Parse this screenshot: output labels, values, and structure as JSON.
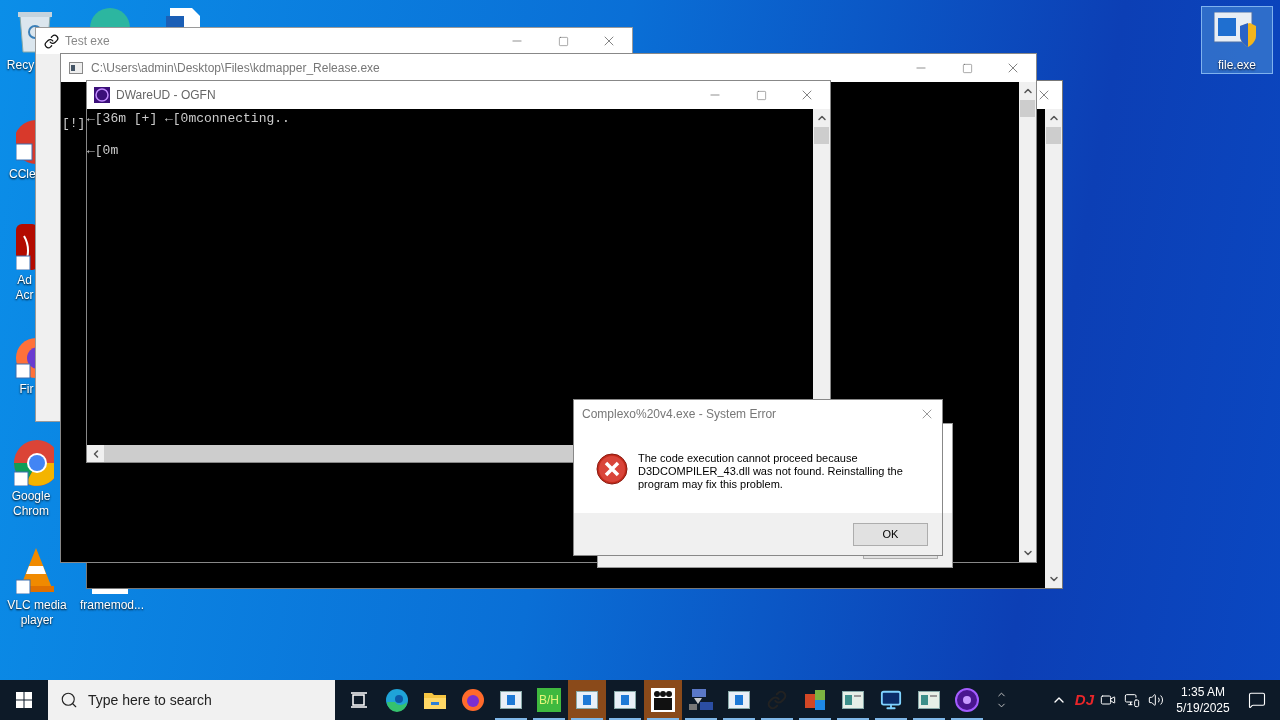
{
  "desktop_icons": [
    {
      "kind": "recycle",
      "label": "Recy"
    },
    {
      "kind": "edge"
    },
    {
      "kind": "document"
    },
    {
      "kind": "ccleaner",
      "label": "CCle"
    },
    {
      "kind": "acrobat",
      "label": "Ad\nAcr"
    },
    {
      "kind": "firefox",
      "label": "Fir"
    },
    {
      "kind": "chrome",
      "label": "Google\nChrom"
    },
    {
      "kind": "vlc",
      "label": "VLC media\nplayer"
    },
    {
      "kind": "blank",
      "label": "framemod..."
    },
    {
      "kind": "shield",
      "label": "file.exe",
      "selected": true
    }
  ],
  "test_window": {
    "title": "Test exe"
  },
  "kdmapper_window": {
    "title": "C:\\Users\\admin\\Desktop\\Files\\kdmapper_Release.exe",
    "lines": [
      "[!]"
    ]
  },
  "dware_window": {
    "title": "DWareUD - OGFN",
    "lines": [
      "←[36m [+] ←[0mconnecting..",
      "←[0m"
    ]
  },
  "error_dialog": {
    "title": "Complexo%20v4.exe - System Error",
    "message": "The code execution cannot proceed because D3DCOMPILER_43.dll was not found. Reinstalling the program may fix this problem.",
    "button": "OK"
  },
  "taskbar": {
    "search": {
      "placeholder": "Type here to search"
    },
    "apps": [
      {
        "kind": "taskview",
        "running": false,
        "active": false
      },
      {
        "kind": "edge",
        "running": false,
        "active": false
      },
      {
        "kind": "folder",
        "running": false,
        "active": false
      },
      {
        "kind": "firefox",
        "running": false,
        "active": false
      },
      {
        "kind": "window",
        "running": true,
        "active": false
      },
      {
        "kind": "text",
        "label": "B/H",
        "running": true,
        "active": false
      },
      {
        "kind": "window",
        "running": true,
        "active": true
      },
      {
        "kind": "window",
        "running": true,
        "active": false
      },
      {
        "kind": "people",
        "running": true,
        "active": true
      },
      {
        "kind": "wizard",
        "running": true,
        "active": false
      },
      {
        "kind": "window",
        "running": true,
        "active": false
      },
      {
        "kind": "link",
        "running": true,
        "active": false
      },
      {
        "kind": "office",
        "running": true,
        "active": false
      },
      {
        "kind": "console",
        "running": true,
        "active": false
      },
      {
        "kind": "monitor",
        "running": true,
        "active": false
      },
      {
        "kind": "console",
        "running": true,
        "active": false
      },
      {
        "kind": "orb",
        "running": true,
        "active": false
      }
    ],
    "tray_badge": "DJ",
    "time": "1:35 AM",
    "date": "5/19/2025"
  }
}
